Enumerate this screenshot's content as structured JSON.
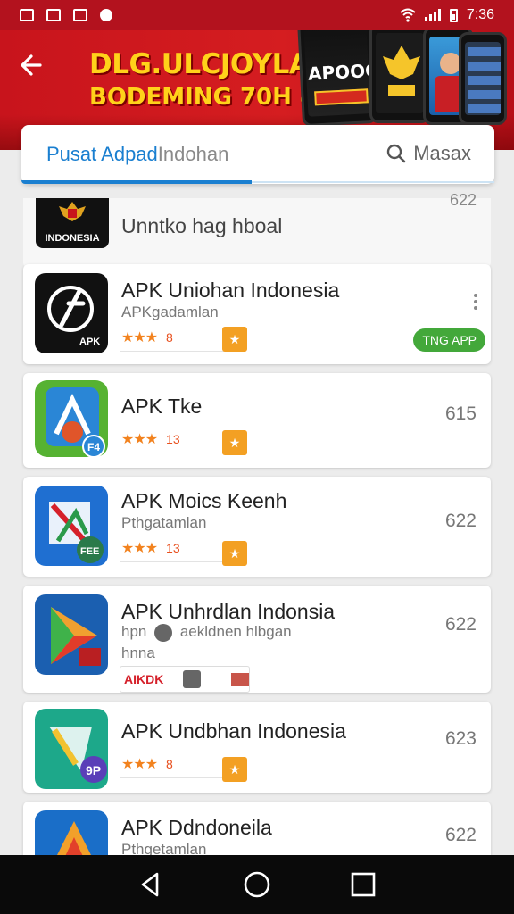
{
  "status_bar": {
    "time": "7:36"
  },
  "banner": {
    "title": "DLG.ULCJOYLAR",
    "subtitle": "BODEMING 70H 4",
    "phone_label": "APOOC"
  },
  "tabs": {
    "active_label": "Pusat Adpad",
    "inactive_label": "Indohan",
    "search_label": "Masax"
  },
  "list_header": {
    "logo_text": "INDONESIA",
    "title": "Unntko hag hboal",
    "number": "622"
  },
  "apps": [
    {
      "name": "APK Uniohan Indonesia",
      "subtitle": "APKgadamlan",
      "rating_stars": "★★★",
      "rating_value": "8",
      "install_label": "TNG APP",
      "icon_colors": [
        "#111111",
        "#111111"
      ]
    },
    {
      "name": "APK Tke",
      "rating_stars": "★★★",
      "rating_value": "13",
      "number": "615",
      "icon_colors": [
        "#56b232",
        "#2a86d6"
      ]
    },
    {
      "name": "APK Moics Keenh",
      "subtitle": "Pthgatamlan",
      "rating_stars": "★★★",
      "rating_value": "13",
      "number": "622",
      "icon_colors": [
        "#1f6fd1",
        "#2a9a4a"
      ]
    },
    {
      "name": "APK Unhrdlan Indonsia",
      "subtitle": "hpn",
      "subtitle2": "aekldnen hlbgan",
      "subtitle3": "hnna",
      "chip_label": "AIKDK",
      "number": "622",
      "icon_colors": [
        "#1b5fb0",
        "#f0a030"
      ]
    },
    {
      "name": "APK Undbhan Indonesia",
      "rating_stars": "★★★",
      "rating_value": "8",
      "number": "623",
      "icon_colors": [
        "#1da88a",
        "#f2c230"
      ]
    },
    {
      "name": "APK Ddndoneila",
      "subtitle": "Pthgetamlan",
      "number": "622",
      "icon_colors": [
        "#1a6ec8",
        "#f2a02a"
      ]
    }
  ]
}
